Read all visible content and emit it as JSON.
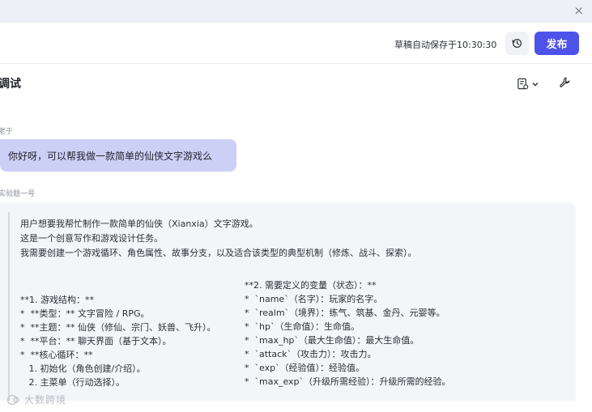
{
  "window": {
    "close_glyph": "×"
  },
  "header": {
    "autosave_text": "草稿自动保存于10:30:30",
    "publish_label": "发布"
  },
  "debug": {
    "title": "调试"
  },
  "conversation": {
    "user": {
      "name": "老于",
      "message": "你好呀，可以帮我做一款简单的仙侠文字游戏么"
    },
    "bot": {
      "name": "实验题一号",
      "intro": [
        "用户想要我帮忙制作一款简单的仙侠（Xianxia）文字游戏。",
        "这是一个创意写作和游戏设计任务。",
        "我需要创建一个游戏循环、角色属性、故事分支，以及适合该类型的典型机制（修炼、战斗、探索）。"
      ],
      "left_column": [
        "**1. 游戏结构：**",
        "*  **类型：** 文字冒险 / RPG。",
        "*  **主题：** 仙侠（修仙、宗门、妖兽、飞升）。",
        "*  **平台：** 聊天界面（基于文本）。",
        "*  **核心循环：**",
        "   1. 初始化（角色创建/介绍）。",
        "   2. 主菜单（行动选择）。"
      ],
      "right_column": [
        "**2. 需要定义的变量（状态）：**",
        "*  `name`（名字）：玩家的名字。",
        "*  `realm`（境界）：练气、筑基、金丹、元婴等。",
        "*  `hp`（生命值）：生命值。",
        "*  `max_hp`（最大生命值）：最大生命值。",
        "*  `attack`（攻击力）：攻击力。",
        "*  `exp`（经验值）：经验值。",
        "*  `max_exp`（升级所需经验）：升级所需的经验。"
      ]
    }
  },
  "watermark": {
    "text": "大数跨境"
  },
  "colors": {
    "accent": "#4d53e8",
    "user_bubble": "#cdd0f6",
    "bot_card": "#f4f5f8",
    "top_strip": "#eef0f8"
  },
  "icons": [
    "close-icon",
    "history-icon",
    "debug-log-icon",
    "chevron-down-icon",
    "wrench-icon",
    "watermark-logo-icon"
  ]
}
